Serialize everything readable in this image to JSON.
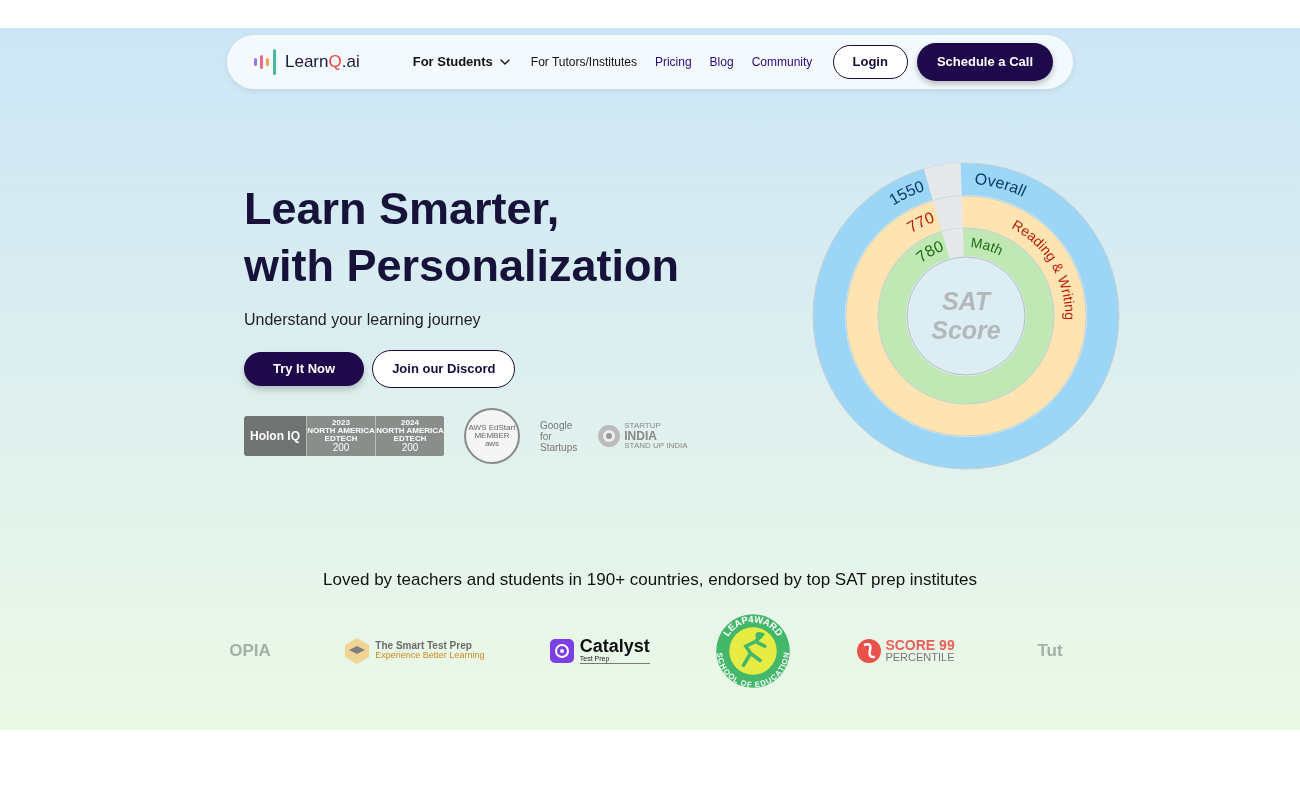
{
  "nav": {
    "brand": {
      "before": "Learn",
      "accent": "Q",
      "after": ".ai"
    },
    "links": [
      {
        "label": "For Students",
        "kind": "dropdown"
      },
      {
        "label": "For Tutors/Institutes",
        "kind": "plain"
      },
      {
        "label": "Pricing",
        "kind": "accent"
      },
      {
        "label": "Blog",
        "kind": "accent"
      },
      {
        "label": "Community",
        "kind": "accent"
      }
    ],
    "login": "Login",
    "cta": "Schedule a Call"
  },
  "hero": {
    "title_lines": [
      "Learn Smarter,",
      "with Personalization"
    ],
    "subtitle": "Understand your learning journey",
    "primary_button": "Try It Now",
    "secondary_button": "Join our Discord"
  },
  "badges": [
    {
      "kind": "holon",
      "brand": "Holon IQ",
      "awards": [
        {
          "year": "2023",
          "region": "NORTH AMERICA",
          "sector": "EDTECH",
          "rank": "200"
        },
        {
          "year": "2024",
          "region": "NORTH AMERICA",
          "sector": "EDTECH",
          "rank": "200"
        }
      ]
    },
    {
      "kind": "aws",
      "lines": [
        "AWS EdStart",
        "MEMBER",
        "aws"
      ]
    },
    {
      "kind": "google",
      "lines": [
        "Google",
        "for",
        "Startups"
      ]
    },
    {
      "kind": "startup",
      "title": "STARTUP",
      "subtitle": "INDIA",
      "tagline": "STAND UP INDIA"
    }
  ],
  "score_graphic": {
    "center": [
      "SAT",
      "Score"
    ],
    "rings": [
      {
        "name": "Overall",
        "score": "1550",
        "color": "#9bd6f7",
        "label": {
          "color": "#0b3a66"
        }
      },
      {
        "name": "Reading & Writing",
        "score": "770",
        "color": "#fde4b0",
        "label": {
          "color": "#b81d0c"
        }
      },
      {
        "name": "Math",
        "score": "780",
        "color": "#bfe8b4",
        "label": {
          "color": "#1d6b12"
        }
      }
    ]
  },
  "partners": {
    "heading": "Loved by teachers and students in 190+ countries, endorsed by top SAT prep institutes",
    "logos": [
      {
        "kind": "faded",
        "text": "OPIA"
      },
      {
        "kind": "smart",
        "title": "The Smart Test Prep",
        "tagline": "Experience Better Learning"
      },
      {
        "kind": "catalyst",
        "title": "Catalyst",
        "subtitle": "Test Prep"
      },
      {
        "kind": "leap",
        "title": "LEAP4WARD",
        "subtitle": "SCHOOL OF EDUCATION"
      },
      {
        "kind": "score",
        "title": "SCORE 99",
        "subtitle": "PERCENTILE"
      },
      {
        "kind": "faded",
        "text": "Tut"
      }
    ]
  }
}
